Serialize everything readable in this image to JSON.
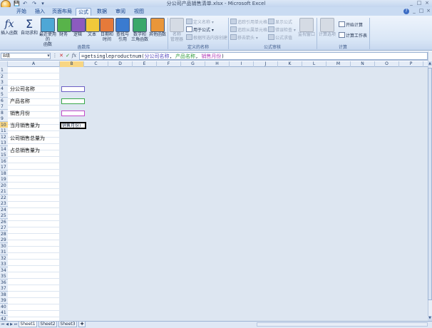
{
  "window": {
    "title": "分公司产品销售清单.xlsx - Microsoft Excel",
    "controls": [
      "_",
      "□",
      "×"
    ]
  },
  "quick_access": [
    "💾",
    "↶",
    "↷",
    "▾"
  ],
  "tabs": [
    "开始",
    "插入",
    "页面布局",
    "公式",
    "数据",
    "审阅",
    "视图"
  ],
  "active_tab": "公式",
  "help_icon": "?",
  "ribbon": {
    "function_library": {
      "label": "函数库",
      "buttons": [
        {
          "id": "insert-function",
          "icon": "fx",
          "line1": "插入函数",
          "line2": ""
        },
        {
          "id": "autosum",
          "icon": "Σ",
          "line1": "自动求和",
          "line2": ""
        },
        {
          "id": "recent",
          "icon": "book",
          "line1": "最近使用的",
          "line2": "函数"
        },
        {
          "id": "financial",
          "icon": "book",
          "line1": "财务",
          "line2": ""
        },
        {
          "id": "logical",
          "icon": "book",
          "line1": "逻辑",
          "line2": ""
        },
        {
          "id": "text",
          "icon": "book",
          "line1": "文本",
          "line2": ""
        },
        {
          "id": "datetime",
          "icon": "book",
          "line1": "日期和",
          "line2": "时间"
        },
        {
          "id": "lookup",
          "icon": "book",
          "line1": "查找与",
          "line2": "引用"
        },
        {
          "id": "mathtrig",
          "icon": "book",
          "line1": "数学和",
          "line2": "三角函数"
        },
        {
          "id": "more",
          "icon": "book",
          "line1": "其他函数",
          "line2": ""
        }
      ]
    },
    "defined_names": {
      "label": "定义的名称",
      "manager": {
        "line1": "名称",
        "line2": "管理器"
      },
      "items": [
        "定义名称 ▾",
        "用于公式 ▾",
        "根据所选内容创建"
      ]
    },
    "formula_auditing": {
      "label": "公式审核",
      "items": [
        "追踪引用单元格",
        "追踪从属单元格",
        "移去箭头 ▾",
        "显示公式",
        "错误检查 ▾",
        "公式求值"
      ],
      "watch": {
        "line1": "监视窗口",
        "line2": ""
      }
    },
    "calculation": {
      "label": "计算",
      "options": {
        "line1": "计算选项",
        "line2": ""
      },
      "items": [
        "开始计算",
        "计算工作表"
      ]
    }
  },
  "formula_bar": {
    "name_box": "B级",
    "cancel": "✕",
    "enter": "✓",
    "fx": "fx",
    "formula_prefix": "=getsingleproductnum(",
    "arg1": "分公司名称",
    "sep1": ", ",
    "arg2": "产品名称",
    "sep2": ", ",
    "arg3": "销售月份",
    "suffix": ")"
  },
  "columns": [
    "A",
    "B",
    "C",
    "D",
    "E",
    "F",
    "G",
    "H",
    "I",
    "J",
    "K",
    "L",
    "M",
    "N",
    "O",
    "P"
  ],
  "selected_column": "B",
  "rows": [
    "1",
    "2",
    "3",
    "4",
    "5",
    "6",
    "7",
    "8",
    "9",
    "10",
    "11",
    "12",
    "13",
    "14",
    "15",
    "16",
    "17",
    "18",
    "19",
    "20",
    "21",
    "22",
    "23",
    "24",
    "25",
    "26",
    "27",
    "28",
    "29",
    "30",
    "31",
    "32",
    "33",
    "34",
    "35",
    "36",
    "37",
    "38",
    "39",
    "40",
    "41",
    "42"
  ],
  "selected_row": "10",
  "cells": {
    "A4": "分公司名称",
    "A6": "产品名称",
    "A8": "销售月份",
    "A10": "当月销售量为",
    "A12": "公司销售总量为",
    "A14": "占总销售量为",
    "B10": "销售月份)"
  },
  "input_colors": {
    "company": "#6c5fc4",
    "product": "#3aa84a",
    "month": "#c24ec9"
  },
  "sheets": [
    "Sheet1",
    "Sheet2",
    "Sheet3"
  ],
  "active_sheet": "Sheet1",
  "sheet_nav": [
    "⏮",
    "◀",
    "▶",
    "⏭"
  ]
}
